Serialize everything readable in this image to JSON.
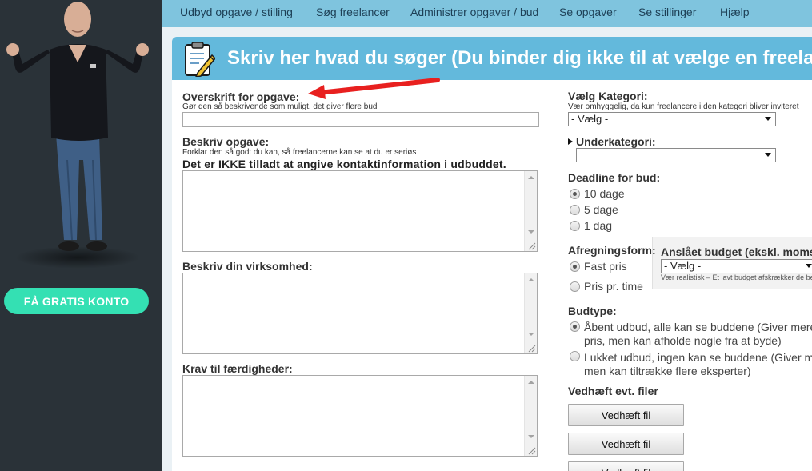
{
  "sidebar": {
    "cta_label": "FÅ GRATIS KONTO"
  },
  "nav": {
    "items": [
      {
        "label": "Udbyd opgave / stilling"
      },
      {
        "label": "Søg freelancer"
      },
      {
        "label": "Administrer opgaver / bud"
      },
      {
        "label": "Se opgaver"
      },
      {
        "label": "Se stillinger"
      },
      {
        "label": "Hjælp"
      }
    ]
  },
  "form": {
    "title": "Skriv her hvad du søger (Du binder dig ikke til at vælge en freelancer)",
    "overskrift": {
      "label": "Overskrift for opgave:",
      "hint": "Gør den så beskrivende som muligt, det giver flere bud",
      "value": ""
    },
    "beskriv": {
      "label": "Beskriv opgave:",
      "hint": "Forklar den så godt du kan, så freelancerne kan se at du er seriøs",
      "warning": "Det er IKKE tilladt at angive kontaktinformation i udbuddet.",
      "value": ""
    },
    "virksomhed": {
      "label": "Beskriv din virksomhed:",
      "value": ""
    },
    "krav": {
      "label": "Krav til færdigheder:",
      "value": ""
    },
    "kategori": {
      "label": "Vælg Kategori:",
      "hint": "Vær omhyggelig, da kun freelancere i den kategori bliver inviteret",
      "selected": "- Vælg -"
    },
    "underkategori": {
      "label": "Underkategori:",
      "selected": ""
    },
    "deadline": {
      "label": "Deadline for bud:",
      "options": [
        "10 dage",
        "5 dage",
        "1 dag"
      ],
      "selected_index": 0
    },
    "afregning": {
      "label": "Afregningsform:",
      "options": [
        "Fast pris",
        "Pris pr. time"
      ],
      "selected_index": 0
    },
    "budget": {
      "label": "Anslået budget (ekskl. moms):",
      "selected": "- Vælg -",
      "hint": "Vær realistisk – Et lavt budget afskrækker de bedste"
    },
    "budtype": {
      "label": "Budtype:",
      "options": [
        {
          "line1": "Åbent udbud, alle kan se buddene (Giver mere konkurrence på",
          "line2": "pris, men kan afholde nogle fra at byde)"
        },
        {
          "line1": "Lukket udbud, ingen kan se buddene (Giver mindre konkurrence,",
          "line2": "men kan tiltrække flere eksperter)"
        }
      ],
      "selected_index": 0
    },
    "vedhaeft": {
      "label": "Vedhæft evt. filer",
      "buttons": [
        "Vedhæft fil",
        "Vedhæft fil",
        "Vedhæft fil"
      ]
    }
  },
  "colors": {
    "nav_bg": "#7fc4de",
    "header_bg": "#63b9dc",
    "sidebar_bg": "#2a3238",
    "cta": "#34e0b3",
    "arrow": "#e8201f"
  },
  "icons": {
    "header": "clipboard-pencil-icon",
    "annotation": "red-arrow"
  }
}
